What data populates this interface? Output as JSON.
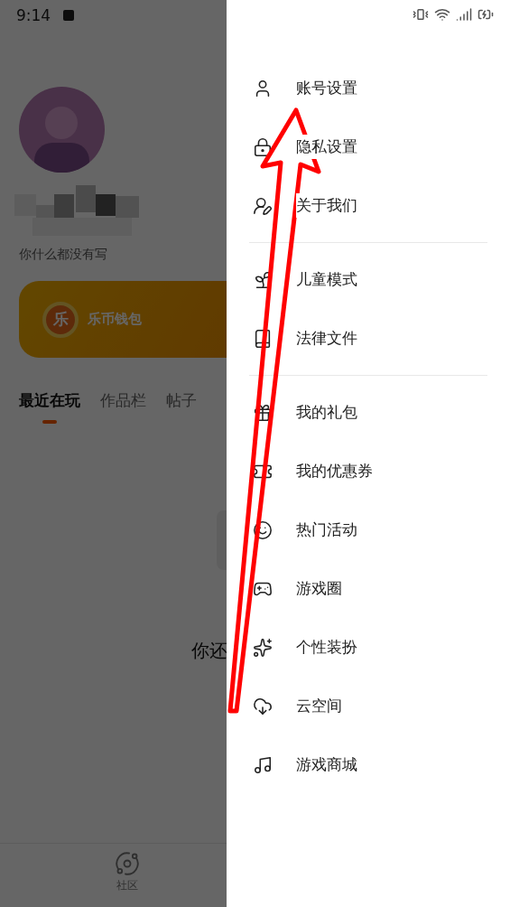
{
  "status_bar": {
    "time": "9:14"
  },
  "profile": {
    "bio": "你什么都没有写"
  },
  "wallet": {
    "coin": "乐",
    "label": "乐币钱包"
  },
  "tabs": [
    {
      "label": "最近在玩",
      "selected": true
    },
    {
      "label": "作品栏",
      "selected": false
    },
    {
      "label": "帖子",
      "selected": false
    }
  ],
  "empty_state": {
    "text": "你还"
  },
  "bottom_nav": [
    {
      "label": "社区"
    }
  ],
  "drawer": {
    "groups": [
      [
        {
          "label": "账号设置"
        },
        {
          "label": "隐私设置"
        },
        {
          "label": "关于我们"
        }
      ],
      [
        {
          "label": "儿童模式"
        },
        {
          "label": "法律文件"
        }
      ],
      [
        {
          "label": "我的礼包"
        },
        {
          "label": "我的优惠券"
        },
        {
          "label": "热门活动"
        },
        {
          "label": "游戏圈"
        },
        {
          "label": "个性装扮"
        },
        {
          "label": "云空间"
        },
        {
          "label": "游戏商城"
        }
      ]
    ]
  }
}
